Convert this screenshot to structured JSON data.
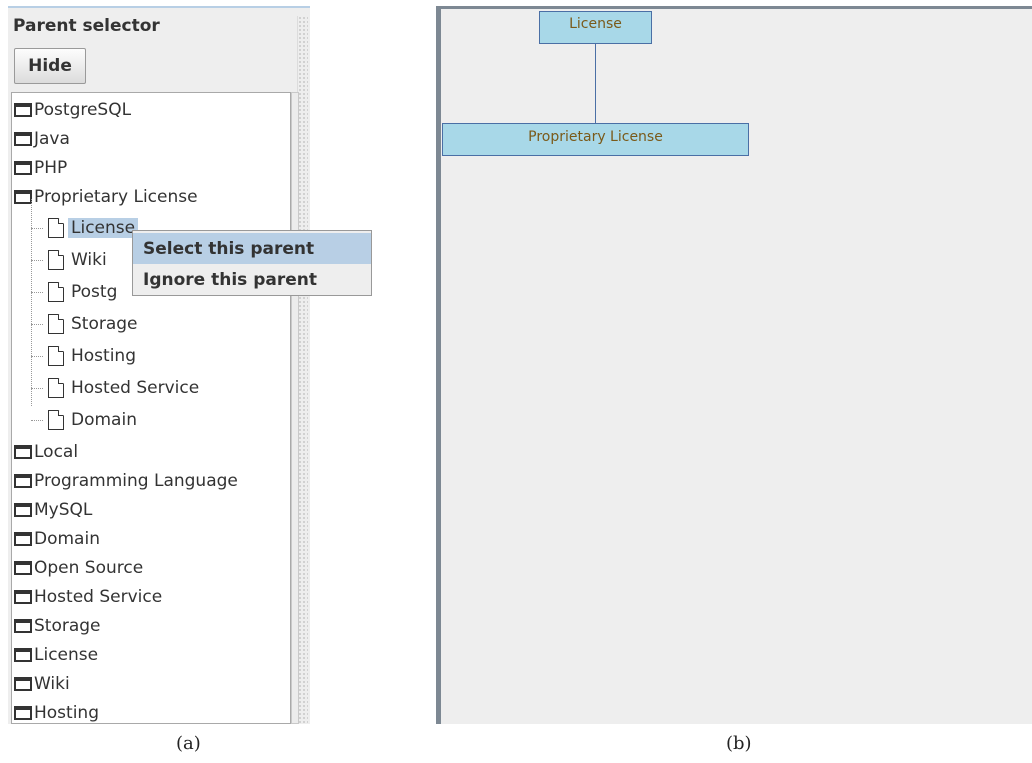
{
  "parent_selector": {
    "title": "Parent selector",
    "hide_label": "Hide",
    "tree": {
      "folders_before": [
        "PostgreSQL",
        "Java",
        "PHP",
        "Proprietary License"
      ],
      "children": [
        "License",
        "Wiki",
        "Postg",
        "Storage",
        "Hosting",
        "Hosted Service",
        "Domain"
      ],
      "folders_after": [
        "Local",
        "Programming Language",
        "MySQL",
        "Domain",
        "Open Source",
        "Hosted Service",
        "Storage",
        "License",
        "Wiki",
        "Hosting"
      ]
    },
    "context_menu": {
      "select_label": "Select this parent",
      "ignore_label": "Ignore this parent"
    }
  },
  "graph": {
    "nodes": [
      "License",
      "Proprietary License"
    ]
  },
  "captions": {
    "a": "(a)",
    "b": "(b)"
  },
  "colors": {
    "selection": "#b8cfe5",
    "node_fill": "#a8d8e8",
    "node_text": "#7a5a1a"
  }
}
